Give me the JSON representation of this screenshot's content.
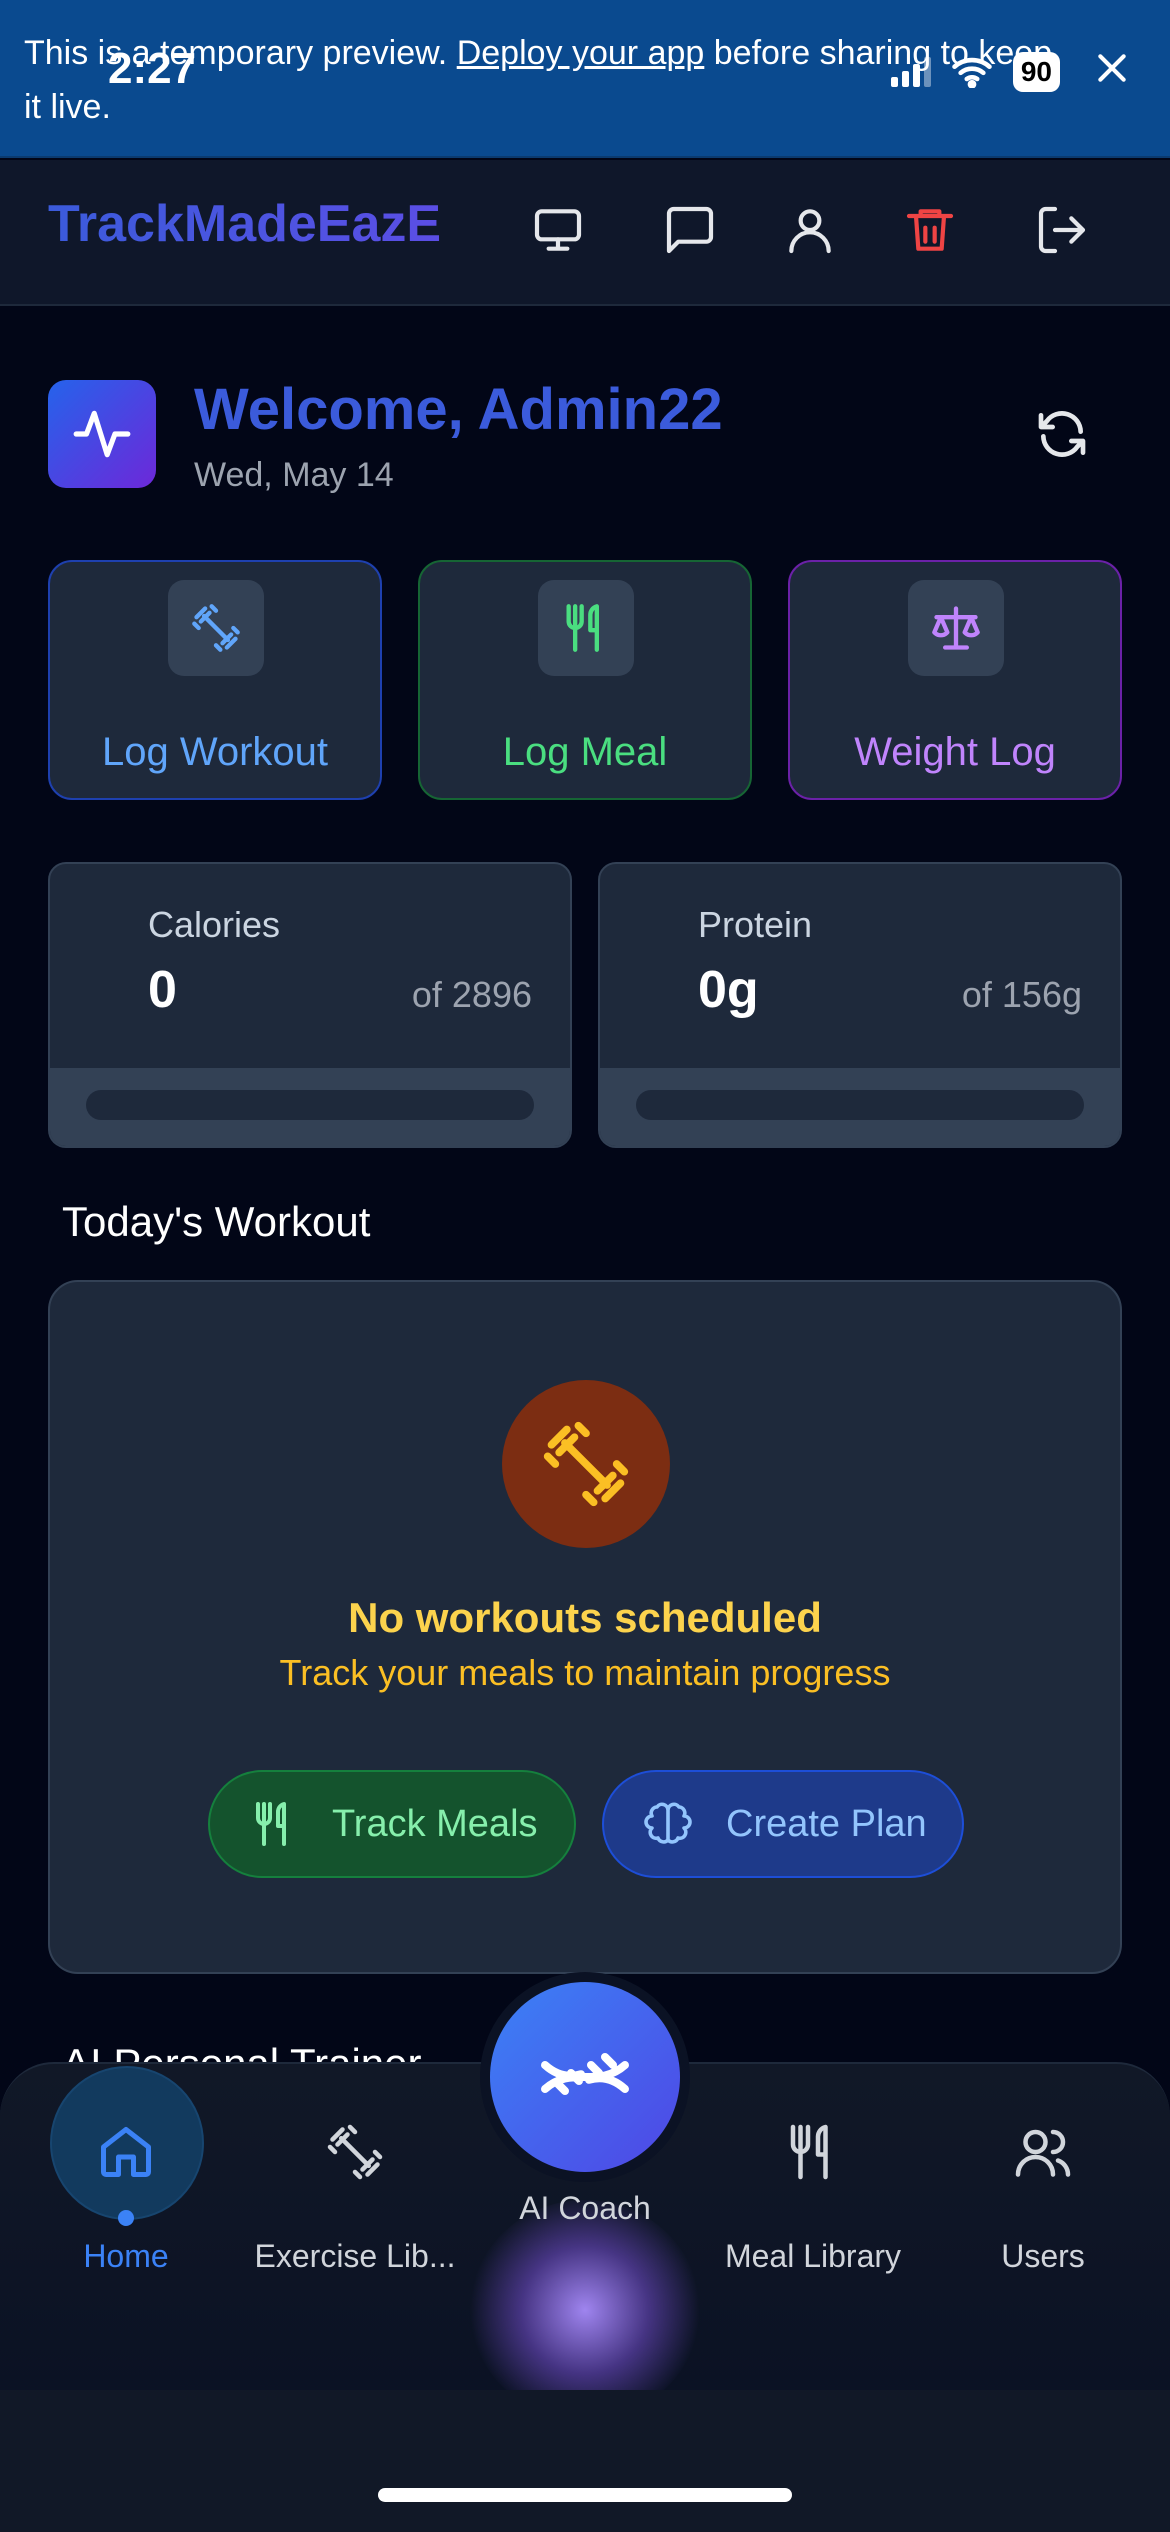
{
  "banner": {
    "text_before": "This is a temporary preview. ",
    "link": "Deploy your app",
    "text_after": " before sharing to keep it live."
  },
  "status": {
    "time": "2:27",
    "battery": "90"
  },
  "header": {
    "brand": "TrackMadeEazE"
  },
  "welcome": {
    "title": "Welcome, Admin22",
    "date": "Wed, May 14"
  },
  "quick_actions": [
    {
      "label": "Log Workout",
      "color": "#60a5fa"
    },
    {
      "label": "Log Meal",
      "color": "#4ade80"
    },
    {
      "label": "Weight Log",
      "color": "#c084fc"
    }
  ],
  "stats": [
    {
      "title": "Calories",
      "value": "0",
      "target": "of 2896",
      "progress": 0
    },
    {
      "title": "Protein",
      "value": "0g",
      "target": "of 156g",
      "progress": 0
    }
  ],
  "workout": {
    "section_title": "Today's Workout",
    "empty_title": "No workouts scheduled",
    "empty_subtitle": "Track your meals to maintain progress",
    "track_meals": "Track Meals",
    "create_plan": "Create Plan"
  },
  "next_section": {
    "title": "AI Personal Trainer"
  },
  "nav": {
    "home": "Home",
    "exercise": "Exercise Lib...",
    "coach": "AI Coach",
    "meals": "Meal Library",
    "users": "Users"
  },
  "colors": {
    "accent": "#3b5bdb",
    "active_nav": "#3b82f6",
    "warning": "#fcd34d",
    "danger": "#ef4444"
  }
}
